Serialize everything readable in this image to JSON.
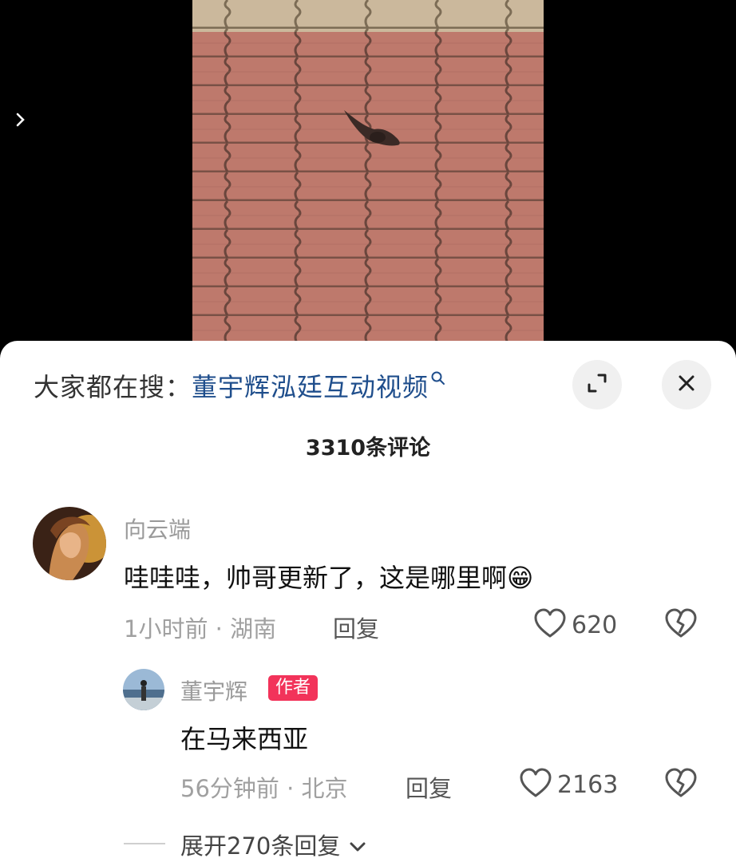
{
  "search": {
    "prefix": "大家都在搜：",
    "query": "董宇辉泓廷互动视频"
  },
  "comments_title": "3310条评论",
  "comment": {
    "username": "向云端",
    "text": "哇哇哇，帅哥更新了，这是哪里啊😁",
    "meta": "1小时前 · 湖南",
    "reply_label": "回复",
    "likes": "620"
  },
  "reply": {
    "username": "董宇辉",
    "badge": "作者",
    "text": "在马来西亚",
    "meta": "56分钟前 · 北京",
    "reply_label": "回复",
    "likes": "2163"
  },
  "expand_replies": "展开270条回复",
  "icons": [
    "chevron-right-icon",
    "search-icon",
    "expand-icon",
    "close-icon",
    "heart-icon",
    "broken-heart-icon",
    "chevron-down-icon"
  ]
}
